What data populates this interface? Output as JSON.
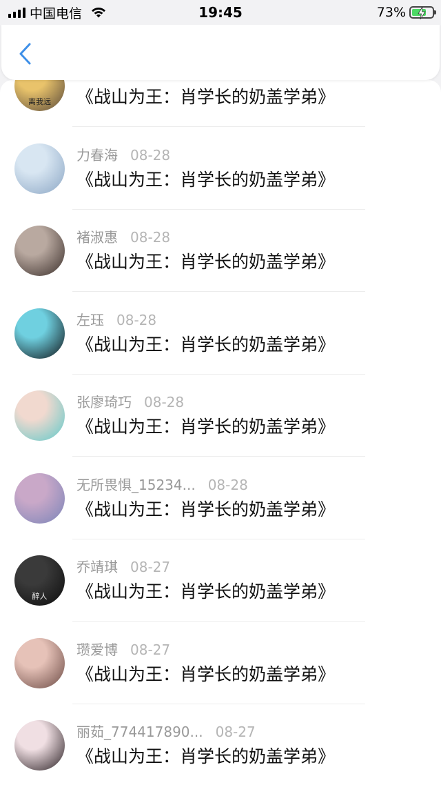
{
  "status_bar": {
    "carrier": "中国电信",
    "time": "19:45",
    "battery_percent": "73%",
    "battery_level": 0.73,
    "icons": [
      "signal-icon",
      "wifi-icon",
      "battery-charging-icon"
    ]
  },
  "nav": {
    "back_icon": "chevron-left-icon",
    "accent_color": "#3d8fe8"
  },
  "messages": [
    {
      "username": "",
      "date": "",
      "text": "《战山为王：肖学长的奶盖学弟》",
      "avatar_colors": [
        "#e9c36b",
        "#5a4a3a"
      ],
      "avatar_caption": "离我远"
    },
    {
      "username": "力春海",
      "date": "08-28",
      "text": "《战山为王：肖学长的奶盖学弟》",
      "avatar_colors": [
        "#d8e6f2",
        "#8ba6c4"
      ],
      "avatar_caption": ""
    },
    {
      "username": "褚淑惠",
      "date": "08-28",
      "text": "《战山为王：肖学长的奶盖学弟》",
      "avatar_colors": [
        "#b9a9a0",
        "#3a2e2a"
      ],
      "avatar_caption": ""
    },
    {
      "username": "左珏",
      "date": "08-28",
      "text": "《战山为王：肖学长的奶盖学弟》",
      "avatar_colors": [
        "#6fd0e0",
        "#101418"
      ],
      "avatar_caption": ""
    },
    {
      "username": "张廖琦巧",
      "date": "08-28",
      "text": "《战山为王：肖学长的奶盖学弟》",
      "avatar_colors": [
        "#f1d9cf",
        "#5ec9c9"
      ],
      "avatar_caption": ""
    },
    {
      "username": "无所畏惧_15234...",
      "date": "08-28",
      "text": "《战山为王：肖学长的奶盖学弟》",
      "avatar_colors": [
        "#c9a8c8",
        "#7a84b8"
      ],
      "avatar_caption": ""
    },
    {
      "username": "乔靖琪",
      "date": "08-27",
      "text": "《战山为王：肖学长的奶盖学弟》",
      "avatar_colors": [
        "#3a3a3a",
        "#0c0c0c"
      ],
      "avatar_caption": "醉人"
    },
    {
      "username": "瓒爱博",
      "date": "08-27",
      "text": "《战山为王：肖学长的奶盖学弟》",
      "avatar_colors": [
        "#e6c2b8",
        "#6b4a44"
      ],
      "avatar_caption": ""
    },
    {
      "username": "丽茹_774417890...",
      "date": "08-27",
      "text": "《战山为王：肖学长的奶盖学弟》",
      "avatar_colors": [
        "#f0dfe3",
        "#2a2024"
      ],
      "avatar_caption": ""
    }
  ]
}
